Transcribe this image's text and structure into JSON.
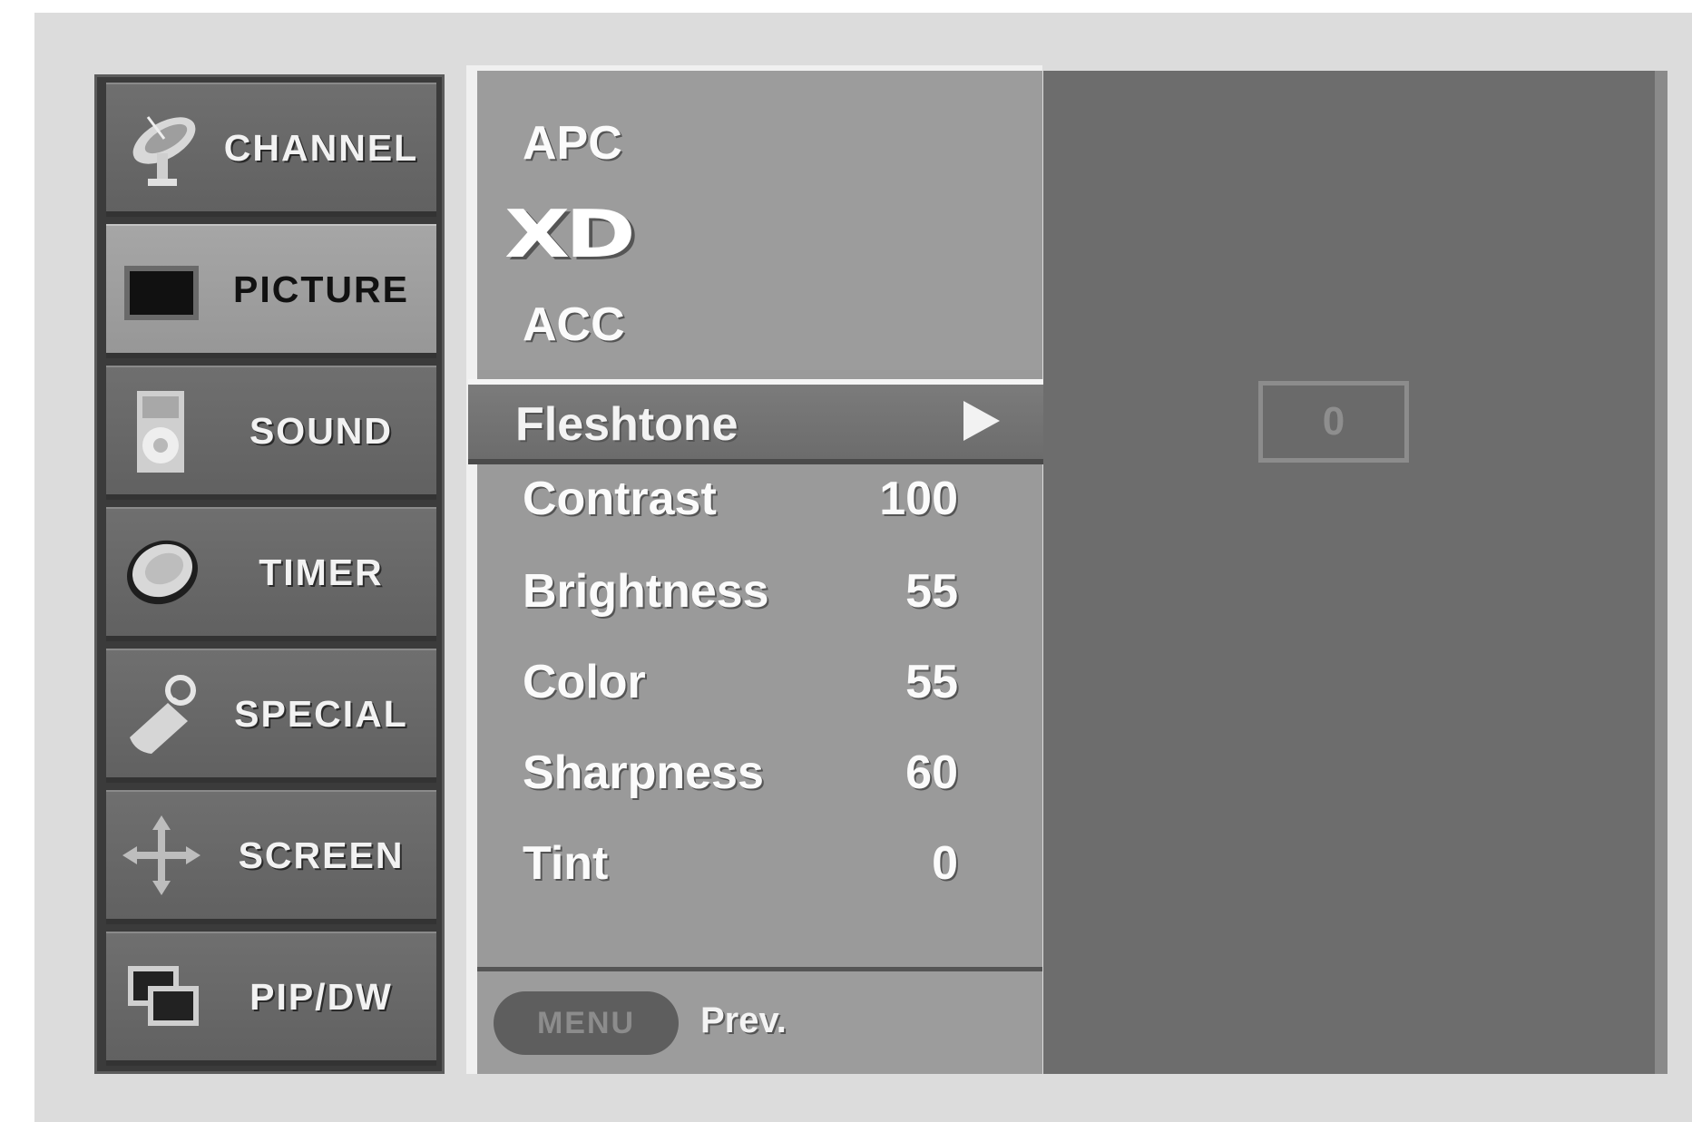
{
  "categories": [
    {
      "label": "CHANNEL",
      "icon": "satellite-dish-icon",
      "active": false
    },
    {
      "label": "PICTURE",
      "icon": "tv-screen-icon",
      "active": true
    },
    {
      "label": "SOUND",
      "icon": "speaker-icon",
      "active": false
    },
    {
      "label": "TIMER",
      "icon": "clock-icon",
      "active": false
    },
    {
      "label": "SPECIAL",
      "icon": "tag-icon",
      "active": false
    },
    {
      "label": "SCREEN",
      "icon": "move-arrows-icon",
      "active": false
    },
    {
      "label": "PIP/DW",
      "icon": "pip-windows-icon",
      "active": false
    }
  ],
  "picture_menu": {
    "apc_label": "APC",
    "xd_label": "XD",
    "acc_label": "ACC",
    "selected": {
      "label": "Fleshtone",
      "value": "0"
    },
    "settings": [
      {
        "name": "Contrast",
        "value": "100"
      },
      {
        "name": "Brightness",
        "value": "55"
      },
      {
        "name": "Color",
        "value": "55"
      },
      {
        "name": "Sharpness",
        "value": "60"
      },
      {
        "name": "Tint",
        "value": "0"
      }
    ],
    "footer": {
      "menu_button": "MENU",
      "prev_label": "Prev."
    }
  },
  "colors": {
    "active_tab": "#a6a6a6",
    "inactive_tab": "#6a6a6a",
    "panel": "#9a9a9a",
    "selection_bar": "#737373",
    "preview": "#6d6d6d"
  }
}
